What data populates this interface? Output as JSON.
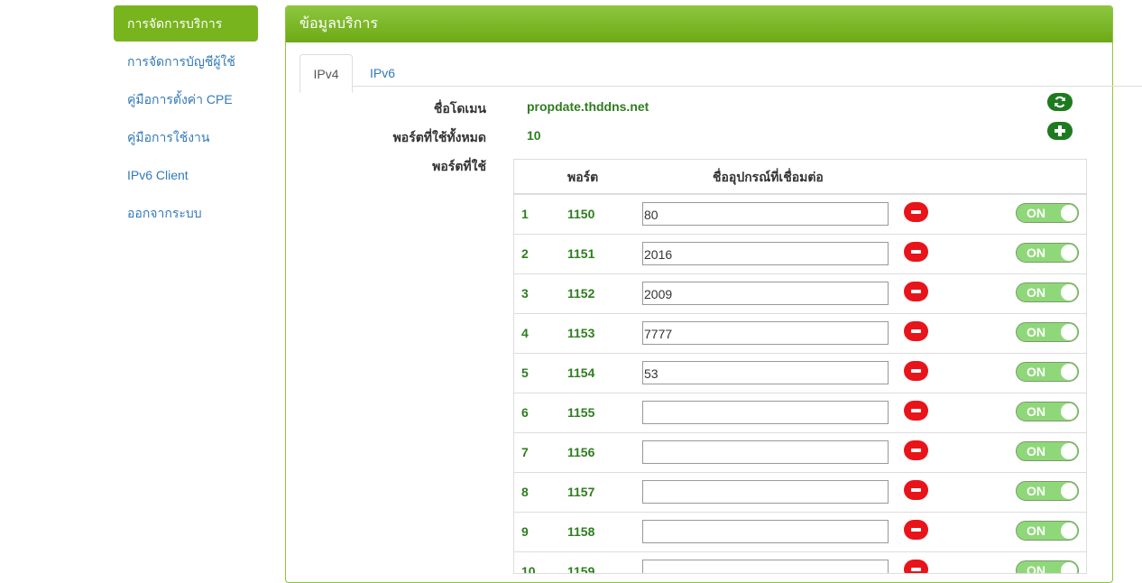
{
  "sidebar": {
    "items": [
      {
        "label": "การจัดการบริการ",
        "active": true
      },
      {
        "label": "การจัดการบัญชีผู้ใช้",
        "active": false
      },
      {
        "label": "คู่มือการตั้งค่า CPE",
        "active": false
      },
      {
        "label": "คู่มือการใช้งาน",
        "active": false
      },
      {
        "label": "IPv6 Client",
        "active": false
      },
      {
        "label": "ออกจากระบบ",
        "active": false
      }
    ]
  },
  "panel": {
    "title": "ข้อมูลบริการ",
    "tabs": [
      {
        "label": "IPv4",
        "active": true
      },
      {
        "label": "IPv6",
        "active": false
      }
    ],
    "domain_label": "ชื่อโดเมน",
    "domain_value": "propdate.thddns.net",
    "ports_total_label": "พอร์ตที่ใช้ทั้งหมด",
    "ports_total_value": "10",
    "ports_used_label": "พอร์ตที่ใช้",
    "refresh_icon": "refresh-icon",
    "add_icon": "plus-icon"
  },
  "table": {
    "headers": {
      "port": "พอร์ต",
      "device": "ชื่ออุปกรณ์ที่เชื่อมต่อ"
    },
    "toggle_label": "ON",
    "rows": [
      {
        "no": "1",
        "port": "1150",
        "device": "80"
      },
      {
        "no": "2",
        "port": "1151",
        "device": "2016"
      },
      {
        "no": "3",
        "port": "1152",
        "device": "2009"
      },
      {
        "no": "4",
        "port": "1153",
        "device": "7777"
      },
      {
        "no": "5",
        "port": "1154",
        "device": "53"
      },
      {
        "no": "6",
        "port": "1155",
        "device": ""
      },
      {
        "no": "7",
        "port": "1156",
        "device": ""
      },
      {
        "no": "8",
        "port": "1157",
        "device": ""
      },
      {
        "no": "9",
        "port": "1158",
        "device": ""
      },
      {
        "no": "10",
        "port": "1159",
        "device": ""
      }
    ]
  },
  "colors": {
    "accent_green": "#78b41e",
    "value_green": "#2e7d1f",
    "delete_red": "#e8141a",
    "toggle_on": "#8fd87a"
  }
}
